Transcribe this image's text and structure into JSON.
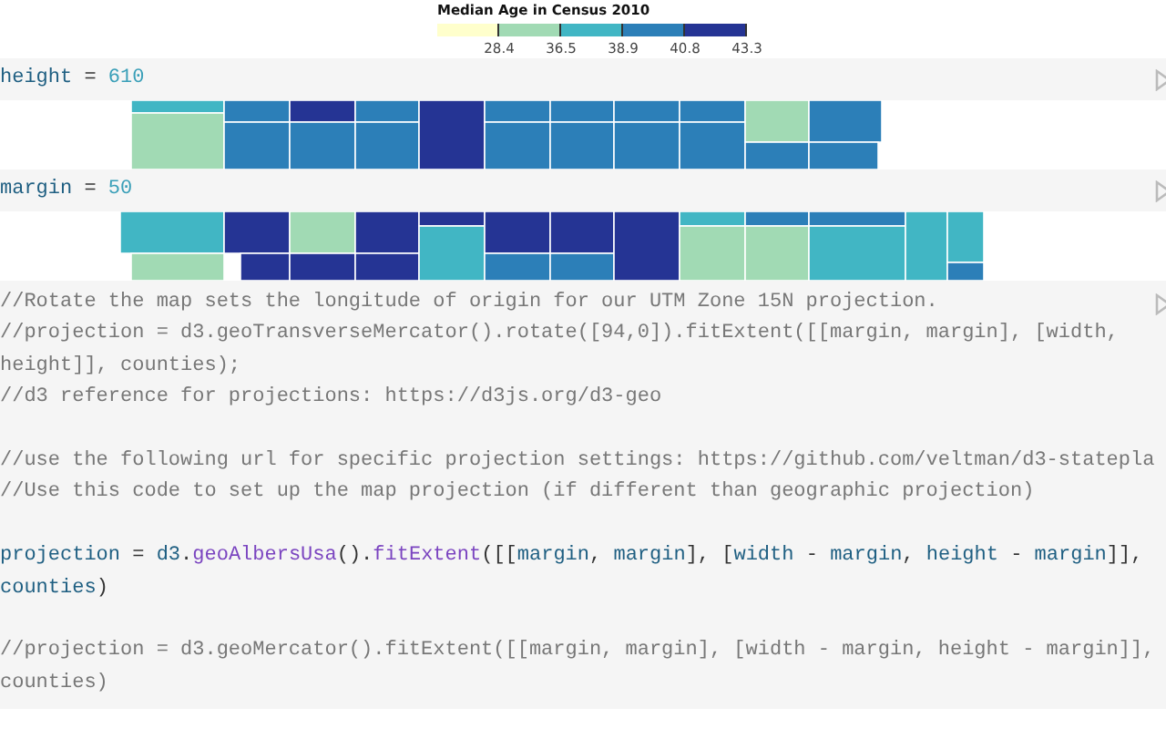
{
  "legend": {
    "title": "Median Age in Census 2010",
    "bins": [
      {
        "color": "#ffffcc",
        "label": "28.4"
      },
      {
        "color": "#a1dab4",
        "label": "36.5"
      },
      {
        "color": "#41b6c4",
        "label": "38.9"
      },
      {
        "color": "#2c7fb8",
        "label": "40.8"
      },
      {
        "color": "#253494",
        "label": "43.3"
      }
    ]
  },
  "cells": [
    {
      "kind": "assign",
      "name": "height",
      "operator": "=",
      "value": "610"
    },
    {
      "kind": "map"
    },
    {
      "kind": "assign",
      "name": "margin",
      "operator": "=",
      "value": "50"
    },
    {
      "kind": "map"
    },
    {
      "kind": "code",
      "paragraphs": [
        [
          [
            {
              "kind": "comment",
              "text": "//Rotate the map sets the longitude of origin for our UTM Zone 15N projection."
            }
          ],
          [
            {
              "kind": "comment",
              "text": "//projection = d3.geoTransverseMercator().rotate([94,0]).fitExtent([[margin, margin], [width,"
            }
          ],
          [
            {
              "kind": "comment",
              "text": "height]], counties);"
            }
          ],
          [
            {
              "kind": "comment",
              "text": "//d3 reference for projections: https://d3js.org/d3-geo"
            }
          ]
        ],
        [
          [
            {
              "kind": "comment",
              "text": "//use the following url for specific projection settings: https://github.com/veltman/d3-statepla"
            }
          ],
          [
            {
              "kind": "comment",
              "text": "//Use this code to set up the map projection (if different than geographic projection)"
            }
          ]
        ],
        [
          [
            {
              "kind": "var",
              "text": "projection"
            },
            {
              "kind": "op",
              "text": " = "
            },
            {
              "kind": "var",
              "text": "d3"
            },
            {
              "kind": "op",
              "text": "."
            },
            {
              "kind": "fn",
              "text": "geoAlbersUsa"
            },
            {
              "kind": "op",
              "text": "()."
            },
            {
              "kind": "fn",
              "text": "fitExtent"
            },
            {
              "kind": "op",
              "text": "([["
            },
            {
              "kind": "var",
              "text": "margin"
            },
            {
              "kind": "op",
              "text": ", "
            },
            {
              "kind": "var",
              "text": "margin"
            },
            {
              "kind": "op",
              "text": "], ["
            },
            {
              "kind": "var",
              "text": "width"
            },
            {
              "kind": "op",
              "text": " - "
            },
            {
              "kind": "var",
              "text": "margin"
            },
            {
              "kind": "op",
              "text": ", "
            },
            {
              "kind": "var",
              "text": "height"
            },
            {
              "kind": "op",
              "text": " - "
            },
            {
              "kind": "var",
              "text": "margin"
            },
            {
              "kind": "op",
              "text": "]],"
            }
          ],
          [
            {
              "kind": "var",
              "text": "counties"
            },
            {
              "kind": "op",
              "text": ")"
            }
          ]
        ],
        [
          [
            {
              "kind": "comment",
              "text": "//projection = d3.geoMercator().fitExtent([[margin, margin], [width - margin, height - margin]],"
            }
          ],
          [
            {
              "kind": "comment",
              "text": "counties)"
            }
          ]
        ]
      ]
    }
  ]
}
